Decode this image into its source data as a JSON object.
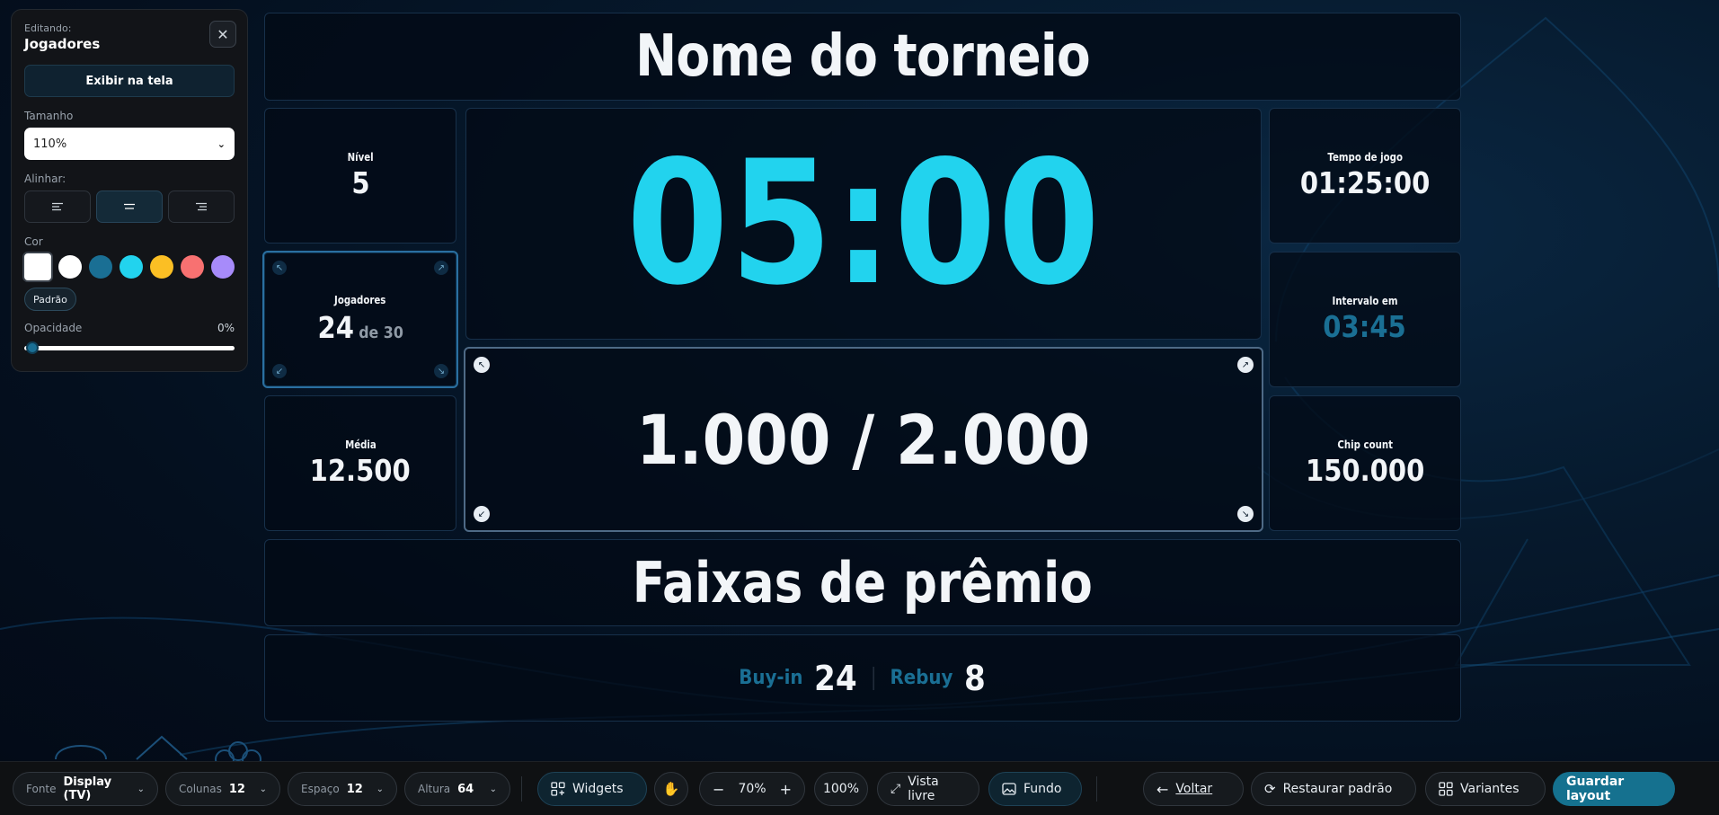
{
  "editor": {
    "editing_label": "Editando:",
    "widget_name": "Jogadores",
    "close_icon": "close-icon",
    "show_button": "Exibir na tela",
    "size_label": "Tamanho",
    "size_value": "110%",
    "align_label": "Alinhar:",
    "align_options": [
      "left",
      "center",
      "right"
    ],
    "align_selected": "center",
    "color_label": "Cor",
    "colors": [
      "#ffffff",
      "#ffffff",
      "#1a6f94",
      "#22d3ee",
      "#fbbf24",
      "#f87171",
      "#a78bfa"
    ],
    "default_color_button": "Padrão",
    "opacity_label": "Opacidade",
    "opacity_value": "0%",
    "opacity_fraction": 0
  },
  "stage": {
    "title": "Nome do torneio",
    "level": {
      "label": "Nível",
      "value": "5"
    },
    "players": {
      "label": "Jogadores",
      "value": "24",
      "of": "de 30"
    },
    "average": {
      "label": "Média",
      "value": "12.500"
    },
    "timer": "05:00",
    "blinds": "1.000 / 2.000",
    "play_time": {
      "label": "Tempo de jogo",
      "value": "01:25:00"
    },
    "break_in": {
      "label": "Intervalo em",
      "value": "03:45"
    },
    "chip_count": {
      "label": "Chip count",
      "value": "150.000"
    },
    "prize_title": "Faixas de prêmio",
    "buyin": {
      "label": "Buy-in",
      "value": "24"
    },
    "rebuy": {
      "label": "Rebuy",
      "value": "8"
    }
  },
  "toolbar": {
    "font": {
      "label": "Fonte",
      "value": "Display (TV)"
    },
    "columns": {
      "label": "Colunas",
      "value": "12"
    },
    "spacing": {
      "label": "Espaço",
      "value": "12"
    },
    "height": {
      "label": "Altura",
      "value": "64"
    },
    "widgets": "Widgets",
    "zoom": "70%",
    "zoom_reset": "100%",
    "free_view": "Vista livre",
    "background": "Fundo",
    "back": "Voltar",
    "restore": "Restaurar padrão",
    "variants": "Variantes",
    "save": "Guardar layout"
  }
}
